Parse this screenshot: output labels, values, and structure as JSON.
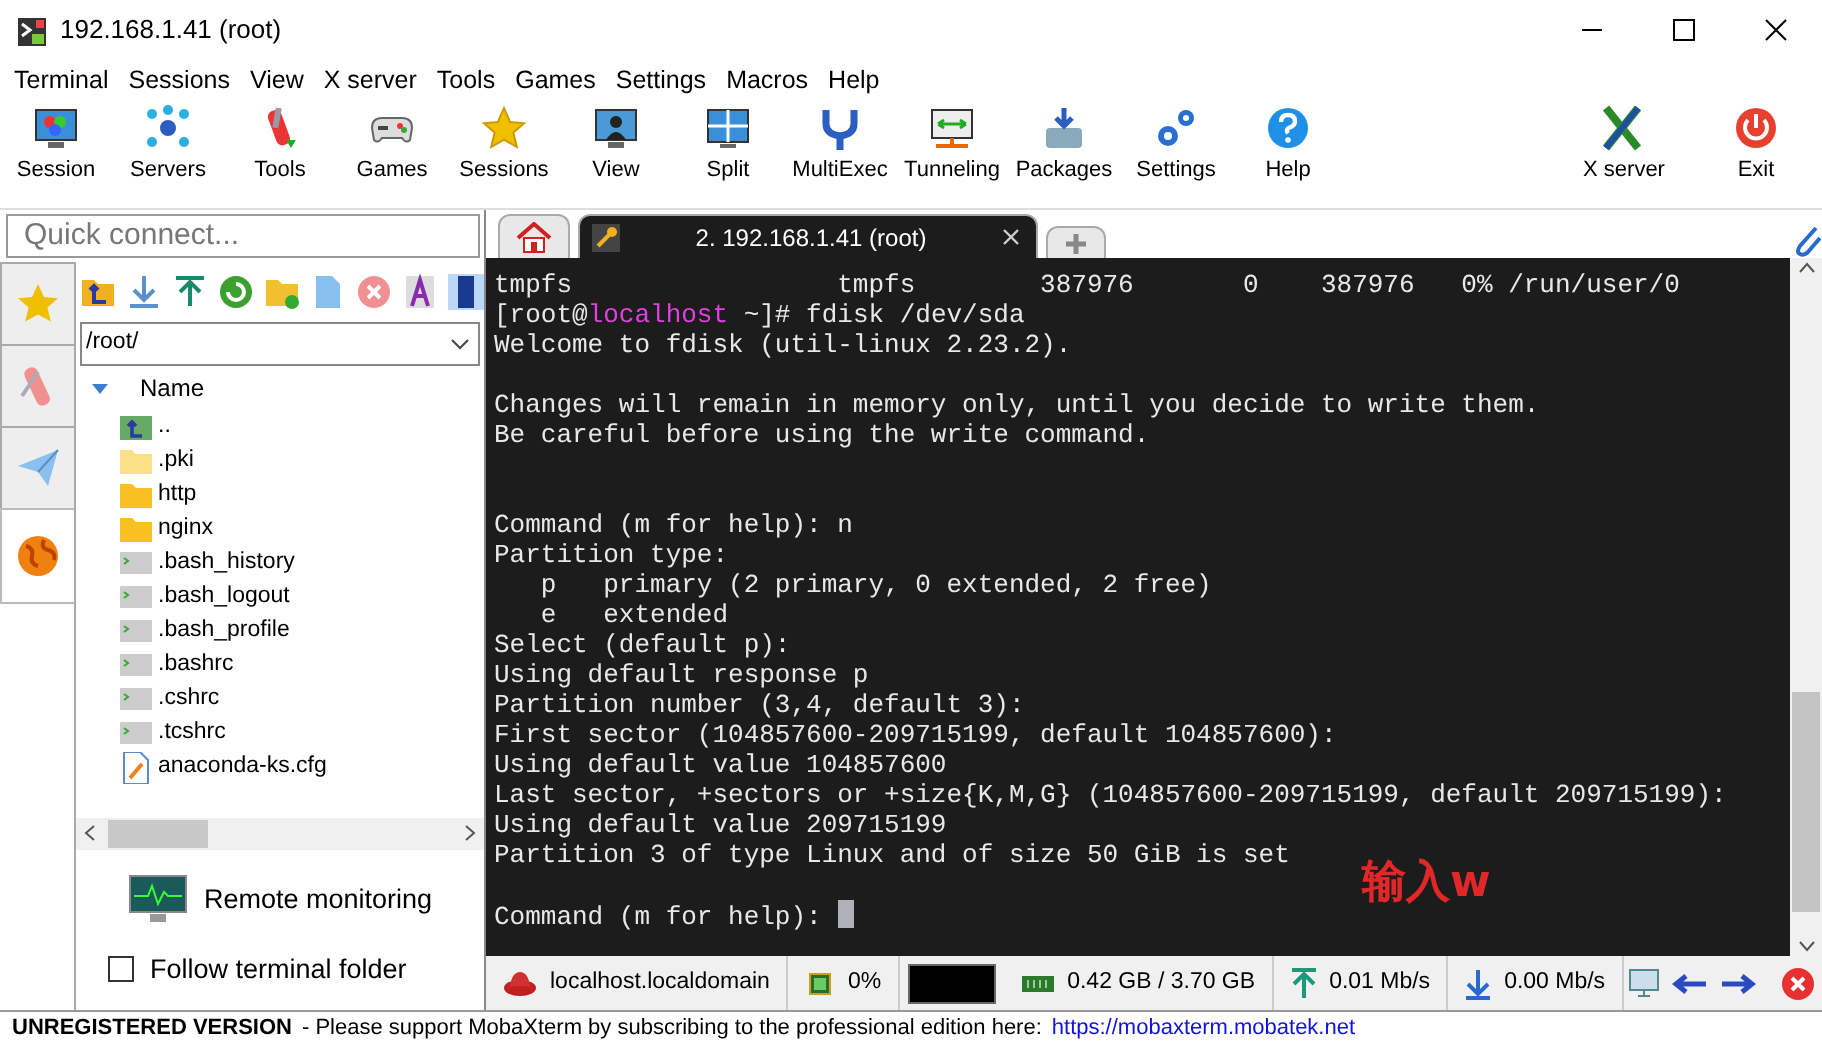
{
  "window": {
    "title": "192.168.1.41 (root)"
  },
  "menu": [
    "Terminal",
    "Sessions",
    "View",
    "X server",
    "Tools",
    "Games",
    "Settings",
    "Macros",
    "Help"
  ],
  "toolbar": {
    "left": [
      "Session",
      "Servers",
      "Tools",
      "Games",
      "Sessions",
      "View",
      "Split",
      "MultiExec",
      "Tunneling",
      "Packages",
      "Settings",
      "Help"
    ],
    "right": [
      "X server",
      "Exit"
    ]
  },
  "quick_connect": {
    "placeholder": "Quick connect..."
  },
  "side_tabs": [
    {
      "selected": false
    },
    {
      "selected": false
    },
    {
      "selected": false
    },
    {
      "selected": true
    }
  ],
  "session_tabs": [
    {
      "kind": "home",
      "selected": false
    },
    {
      "kind": "session",
      "label": "2. 192.168.1.41 (root)",
      "selected": true
    },
    {
      "kind": "add",
      "selected": false
    }
  ],
  "file_browser": {
    "path": "/root/",
    "column": "Name",
    "items": [
      {
        "kind": "up",
        "name": ".."
      },
      {
        "kind": "hidden-folder",
        "name": ".pki"
      },
      {
        "kind": "folder",
        "name": "http"
      },
      {
        "kind": "folder",
        "name": "nginx"
      },
      {
        "kind": "script",
        "name": ".bash_history"
      },
      {
        "kind": "script",
        "name": ".bash_logout"
      },
      {
        "kind": "script",
        "name": ".bash_profile"
      },
      {
        "kind": "script",
        "name": ".bashrc"
      },
      {
        "kind": "script",
        "name": ".cshrc"
      },
      {
        "kind": "script",
        "name": ".tcshrc"
      },
      {
        "kind": "config",
        "name": "anaconda-ks.cfg"
      }
    ],
    "remote_monitoring": "Remote monitoring",
    "follow_terminal_folder": {
      "label": "Follow terminal folder",
      "checked": false
    }
  },
  "terminal": {
    "lines": [
      [
        {
          "text": "tmpfs                 tmpfs        387976       0    387976   0% /run/user/0"
        }
      ],
      [
        {
          "text": "[root@"
        },
        {
          "text": "localhost",
          "color": "#e040e0"
        },
        {
          "text": " ~]# fdisk /dev/sda"
        }
      ],
      [
        {
          "text": "Welcome to fdisk (util-linux 2.23.2)."
        }
      ],
      [
        {
          "kind": "blank"
        }
      ],
      [
        {
          "text": "Changes will remain in memory only, until you decide to write them."
        }
      ],
      [
        {
          "text": "Be careful before using the write command."
        }
      ],
      [
        {
          "kind": "blank"
        }
      ],
      [
        {
          "kind": "blank"
        }
      ],
      [
        {
          "text": "Command (m for help): n"
        }
      ],
      [
        {
          "text": "Partition type:"
        }
      ],
      [
        {
          "text": "   p   primary (2 primary, 0 extended, 2 free)"
        }
      ],
      [
        {
          "text": "   e   extended"
        }
      ],
      [
        {
          "text": "Select (default p):"
        }
      ],
      [
        {
          "text": "Using default response p"
        }
      ],
      [
        {
          "text": "Partition number (3,4, default 3):"
        }
      ],
      [
        {
          "text": "First sector (104857600-209715199, default 104857600):"
        }
      ],
      [
        {
          "text": "Using default value 104857600"
        }
      ],
      [
        {
          "text": "Last sector, +sectors or +size{K,M,G} (104857600-209715199, default 209715199):"
        }
      ],
      [
        {
          "text": "Using default value 209715199"
        }
      ],
      [
        {
          "text": "Partition 3 of type Linux and of size 50 GiB is set"
        }
      ],
      [
        {
          "kind": "blank"
        }
      ],
      [
        {
          "text": "Command (m for help): "
        },
        {
          "kind": "cursor"
        }
      ]
    ],
    "annotation": "输入w"
  },
  "terminal_status": {
    "host": "localhost.localdomain",
    "cpu": "0%",
    "memory": "0.42 GB / 3.70 GB",
    "upload": "0.01 Mb/s",
    "download": "0.00 Mb/s"
  },
  "status_bar": {
    "label": "UNREGISTERED VERSION",
    "message": "- Please support MobaXterm by subscribing to the professional edition here:",
    "link": "https://mobaxterm.mobatek.net"
  }
}
